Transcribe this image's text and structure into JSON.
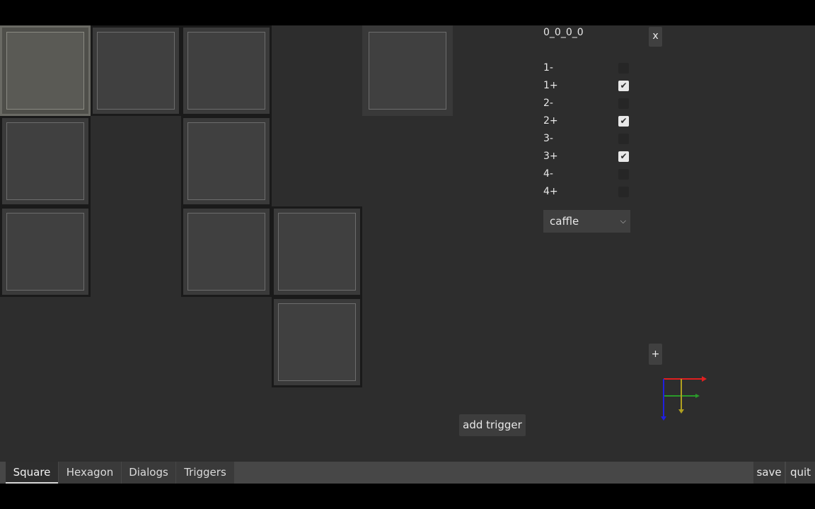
{
  "panel": {
    "title": "0_0_0_0",
    "close_label": "x",
    "checkboxes": [
      {
        "label": "1-",
        "checked": false
      },
      {
        "label": "1+",
        "checked": true
      },
      {
        "label": "2-",
        "checked": false
      },
      {
        "label": "2+",
        "checked": true
      },
      {
        "label": "3-",
        "checked": false
      },
      {
        "label": "3+",
        "checked": true
      },
      {
        "label": "4-",
        "checked": false
      },
      {
        "label": "4+",
        "checked": false
      }
    ],
    "select_value": "caffle",
    "plus_label": "+"
  },
  "add_trigger_label": "add trigger",
  "gizmo": {
    "x_color": "#e02020",
    "y_color": "#2a9a2a",
    "z_color": "#2020e0",
    "w_color": "#b0a020"
  },
  "tabs": [
    {
      "label": "Square",
      "active": true
    },
    {
      "label": "Hexagon",
      "active": false
    },
    {
      "label": "Dialogs",
      "active": false
    },
    {
      "label": "Triggers",
      "active": false
    }
  ],
  "buttons": {
    "save": "save",
    "quit": "quit"
  },
  "check_glyph": "✔"
}
